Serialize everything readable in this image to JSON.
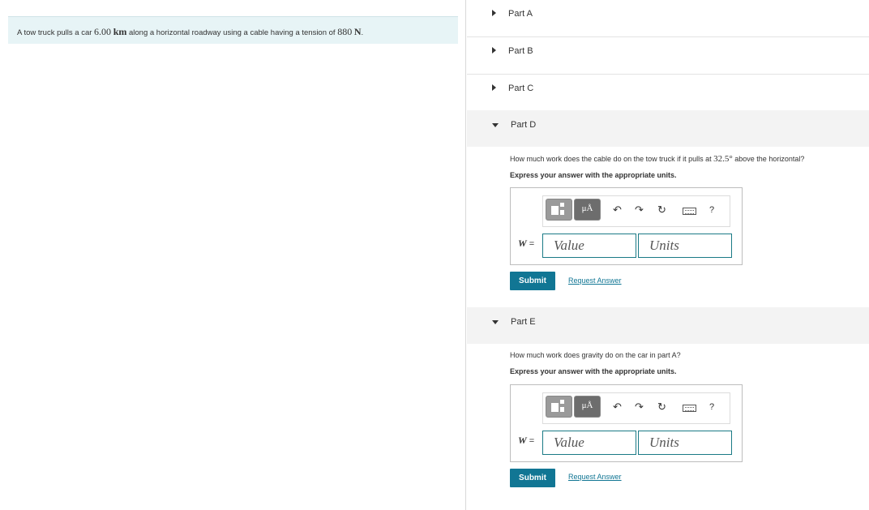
{
  "problem": {
    "text_before": "A tow truck pulls a car ",
    "distance_value": "6.00",
    "distance_unit": "km",
    "text_middle": " along a horizontal roadway using a cable having a tension of ",
    "tension_value": "880",
    "tension_unit": "N",
    "text_end": "."
  },
  "parts": {
    "a": {
      "label": "Part A"
    },
    "b": {
      "label": "Part B"
    },
    "c": {
      "label": "Part C"
    },
    "d": {
      "label": "Part D",
      "question_before": "How much work does the cable do on the tow truck if it pulls at ",
      "angle": "32.5°",
      "question_after": " above the horizontal?",
      "instruction": "Express your answer with the appropriate units.",
      "var_symbol": "W",
      "var_eq": " =",
      "value_placeholder": "Value",
      "units_placeholder": "Units",
      "submit_label": "Submit",
      "request_label": "Request Answer"
    },
    "e": {
      "label": "Part E",
      "question": "How much work does gravity do on the car in part A?",
      "instruction": "Express your answer with the appropriate units.",
      "var_symbol": "W",
      "var_eq": " =",
      "value_placeholder": "Value",
      "units_placeholder": "Units",
      "submit_label": "Submit",
      "request_label": "Request Answer"
    }
  },
  "toolbar": {
    "units_button": "μÅ",
    "undo_icon": "↶",
    "redo_icon": "↷",
    "reset_icon": "↻",
    "help_label": "?"
  },
  "colors": {
    "accent": "#117694",
    "problem_bg": "#e7f4f6",
    "field_border": "#1a7a86"
  }
}
